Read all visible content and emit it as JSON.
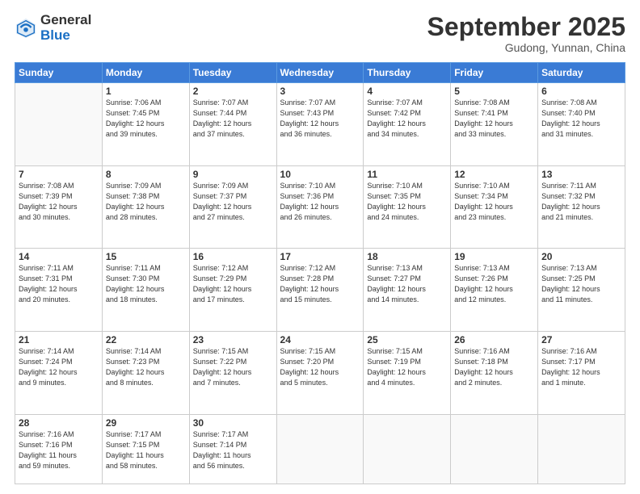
{
  "logo": {
    "general": "General",
    "blue": "Blue"
  },
  "header": {
    "month": "September 2025",
    "location": "Gudong, Yunnan, China"
  },
  "days_of_week": [
    "Sunday",
    "Monday",
    "Tuesday",
    "Wednesday",
    "Thursday",
    "Friday",
    "Saturday"
  ],
  "weeks": [
    [
      {
        "day": "",
        "info": ""
      },
      {
        "day": "1",
        "info": "Sunrise: 7:06 AM\nSunset: 7:45 PM\nDaylight: 12 hours\nand 39 minutes."
      },
      {
        "day": "2",
        "info": "Sunrise: 7:07 AM\nSunset: 7:44 PM\nDaylight: 12 hours\nand 37 minutes."
      },
      {
        "day": "3",
        "info": "Sunrise: 7:07 AM\nSunset: 7:43 PM\nDaylight: 12 hours\nand 36 minutes."
      },
      {
        "day": "4",
        "info": "Sunrise: 7:07 AM\nSunset: 7:42 PM\nDaylight: 12 hours\nand 34 minutes."
      },
      {
        "day": "5",
        "info": "Sunrise: 7:08 AM\nSunset: 7:41 PM\nDaylight: 12 hours\nand 33 minutes."
      },
      {
        "day": "6",
        "info": "Sunrise: 7:08 AM\nSunset: 7:40 PM\nDaylight: 12 hours\nand 31 minutes."
      }
    ],
    [
      {
        "day": "7",
        "info": "Sunrise: 7:08 AM\nSunset: 7:39 PM\nDaylight: 12 hours\nand 30 minutes."
      },
      {
        "day": "8",
        "info": "Sunrise: 7:09 AM\nSunset: 7:38 PM\nDaylight: 12 hours\nand 28 minutes."
      },
      {
        "day": "9",
        "info": "Sunrise: 7:09 AM\nSunset: 7:37 PM\nDaylight: 12 hours\nand 27 minutes."
      },
      {
        "day": "10",
        "info": "Sunrise: 7:10 AM\nSunset: 7:36 PM\nDaylight: 12 hours\nand 26 minutes."
      },
      {
        "day": "11",
        "info": "Sunrise: 7:10 AM\nSunset: 7:35 PM\nDaylight: 12 hours\nand 24 minutes."
      },
      {
        "day": "12",
        "info": "Sunrise: 7:10 AM\nSunset: 7:34 PM\nDaylight: 12 hours\nand 23 minutes."
      },
      {
        "day": "13",
        "info": "Sunrise: 7:11 AM\nSunset: 7:32 PM\nDaylight: 12 hours\nand 21 minutes."
      }
    ],
    [
      {
        "day": "14",
        "info": "Sunrise: 7:11 AM\nSunset: 7:31 PM\nDaylight: 12 hours\nand 20 minutes."
      },
      {
        "day": "15",
        "info": "Sunrise: 7:11 AM\nSunset: 7:30 PM\nDaylight: 12 hours\nand 18 minutes."
      },
      {
        "day": "16",
        "info": "Sunrise: 7:12 AM\nSunset: 7:29 PM\nDaylight: 12 hours\nand 17 minutes."
      },
      {
        "day": "17",
        "info": "Sunrise: 7:12 AM\nSunset: 7:28 PM\nDaylight: 12 hours\nand 15 minutes."
      },
      {
        "day": "18",
        "info": "Sunrise: 7:13 AM\nSunset: 7:27 PM\nDaylight: 12 hours\nand 14 minutes."
      },
      {
        "day": "19",
        "info": "Sunrise: 7:13 AM\nSunset: 7:26 PM\nDaylight: 12 hours\nand 12 minutes."
      },
      {
        "day": "20",
        "info": "Sunrise: 7:13 AM\nSunset: 7:25 PM\nDaylight: 12 hours\nand 11 minutes."
      }
    ],
    [
      {
        "day": "21",
        "info": "Sunrise: 7:14 AM\nSunset: 7:24 PM\nDaylight: 12 hours\nand 9 minutes."
      },
      {
        "day": "22",
        "info": "Sunrise: 7:14 AM\nSunset: 7:23 PM\nDaylight: 12 hours\nand 8 minutes."
      },
      {
        "day": "23",
        "info": "Sunrise: 7:15 AM\nSunset: 7:22 PM\nDaylight: 12 hours\nand 7 minutes."
      },
      {
        "day": "24",
        "info": "Sunrise: 7:15 AM\nSunset: 7:20 PM\nDaylight: 12 hours\nand 5 minutes."
      },
      {
        "day": "25",
        "info": "Sunrise: 7:15 AM\nSunset: 7:19 PM\nDaylight: 12 hours\nand 4 minutes."
      },
      {
        "day": "26",
        "info": "Sunrise: 7:16 AM\nSunset: 7:18 PM\nDaylight: 12 hours\nand 2 minutes."
      },
      {
        "day": "27",
        "info": "Sunrise: 7:16 AM\nSunset: 7:17 PM\nDaylight: 12 hours\nand 1 minute."
      }
    ],
    [
      {
        "day": "28",
        "info": "Sunrise: 7:16 AM\nSunset: 7:16 PM\nDaylight: 11 hours\nand 59 minutes."
      },
      {
        "day": "29",
        "info": "Sunrise: 7:17 AM\nSunset: 7:15 PM\nDaylight: 11 hours\nand 58 minutes."
      },
      {
        "day": "30",
        "info": "Sunrise: 7:17 AM\nSunset: 7:14 PM\nDaylight: 11 hours\nand 56 minutes."
      },
      {
        "day": "",
        "info": ""
      },
      {
        "day": "",
        "info": ""
      },
      {
        "day": "",
        "info": ""
      },
      {
        "day": "",
        "info": ""
      }
    ]
  ]
}
